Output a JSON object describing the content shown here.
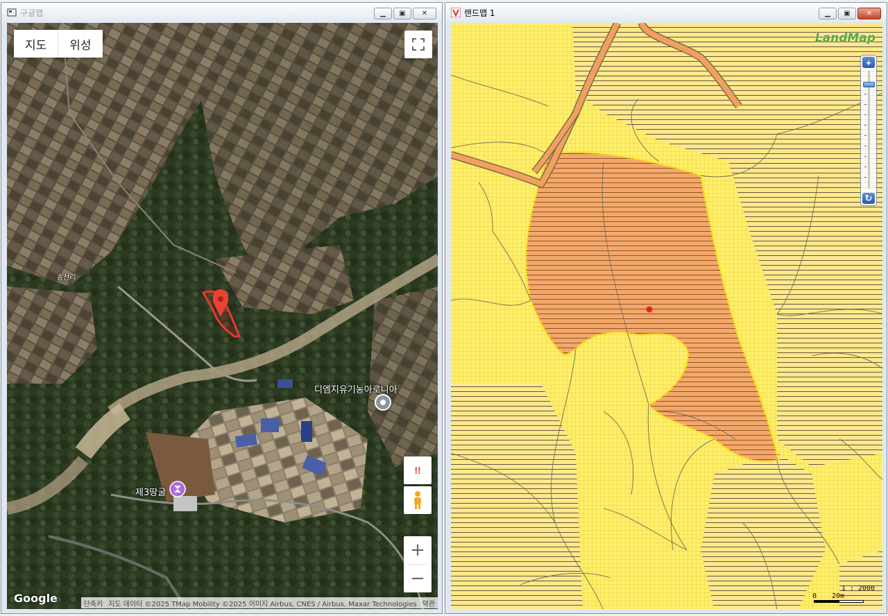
{
  "left_window": {
    "title": "구글맵",
    "map_type": {
      "map_label": "지도",
      "satellite_label": "위성"
    },
    "labels": {
      "village": "송산리",
      "farm": "디엠지유기농아로니아",
      "cave": "제3땅굴"
    },
    "alert_button_label": "!!",
    "zoom": {
      "in_label": "+",
      "out_label": "−"
    },
    "logo": "Google",
    "attribution": {
      "shortcuts": "단축키",
      "data": "지도 데이터 ©2025 TMap Mobility ©2025 이미지 Airbus, CNES / Airbus, Maxar Technologies",
      "terms": "약관"
    }
  },
  "right_window": {
    "title": "랜드맵 1",
    "logo": "LandMap",
    "zoom": {
      "in_label": "+",
      "reset_label": "↻"
    },
    "scale": {
      "ratio": "1 : 2000",
      "zero": "0",
      "distance": "20m"
    }
  },
  "colors": {
    "land_yellow": "#ffef6a",
    "parcel_orange": "#f3a86a",
    "road": "#f2a060",
    "marker_red": "#e02b22",
    "landmap_green": "#5aa742"
  }
}
